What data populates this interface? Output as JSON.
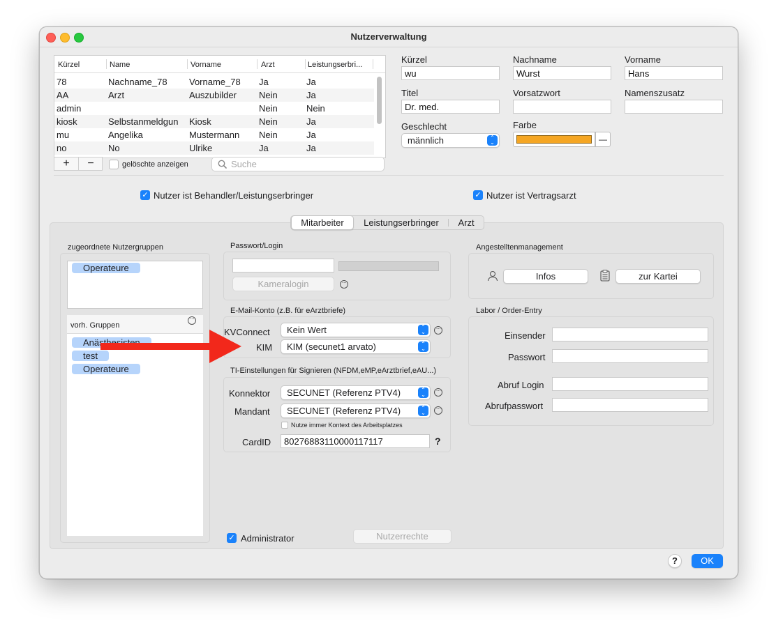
{
  "window": {
    "title": "Nutzerverwaltung"
  },
  "table": {
    "columns": [
      "Kürzel",
      "Name",
      "Vorname",
      "Arzt",
      "Leistungserbri..."
    ],
    "rows": [
      [
        "78",
        "Nachname_78",
        "Vorname_78",
        "Ja",
        "Ja"
      ],
      [
        "AA",
        "Arzt",
        "Auszubilder",
        "Nein",
        "Ja"
      ],
      [
        "admin",
        "",
        "",
        "Nein",
        "Nein"
      ],
      [
        "kiosk",
        "Selbstanmeldgun",
        "Kiosk",
        "Nein",
        "Ja"
      ],
      [
        "mu",
        "Angelika",
        "Mustermann",
        "Nein",
        "Ja"
      ],
      [
        "no",
        "No",
        "Ulrike",
        "Ja",
        "Ja"
      ]
    ],
    "add_label": "+",
    "remove_label": "−",
    "show_deleted_label": "gelöschte anzeigen",
    "search_placeholder": "Suche"
  },
  "person": {
    "kuerzel_label": "Kürzel",
    "kuerzel_value": "wu",
    "nachname_label": "Nachname",
    "nachname_value": "Wurst",
    "vorname_label": "Vorname",
    "vorname_value": "Hans",
    "titel_label": "Titel",
    "titel_value": "Dr. med.",
    "vorsatzwort_label": "Vorsatzwort",
    "vorsatzwort_value": "",
    "namenszusatz_label": "Namenszusatz",
    "namenszusatz_value": "",
    "geschlecht_label": "Geschlecht",
    "geschlecht_value": "männlich",
    "farbe_label": "Farbe",
    "farbe_color": "#f5a623",
    "farbe_button": "—"
  },
  "flags": {
    "behandler_label": "Nutzer ist Behandler/Leistungserbringer",
    "vertragsarzt_label": "Nutzer ist Vertragsarzt"
  },
  "tabs": [
    "Mitarbeiter",
    "Leistungserbringer",
    "Arzt"
  ],
  "groups": {
    "assigned_title": "zugeordnete Nutzergruppen",
    "assigned": [
      "Operateure"
    ],
    "available_title": "vorh. Gruppen",
    "available": [
      "Anästhesisten",
      "test",
      "Operateure"
    ]
  },
  "login": {
    "title": "Passwort/Login",
    "camera_button": "Kameralogin"
  },
  "email": {
    "title": "E-Mail-Konto (z.B. für eArztbriefe)",
    "kvconnect_label": "KVConnect",
    "kvconnect_value": "Kein Wert",
    "kim_label": "KIM",
    "kim_value": "KIM (secunet1 arvato)"
  },
  "ti": {
    "title": "TI-Einstellungen für Signieren (NFDM,eMP,eArztbrief,eAU...)",
    "konnektor_label": "Konnektor",
    "konnektor_value": "SECUNET (Referenz PTV4)",
    "mandant_label": "Mandant",
    "mandant_value": "SECUNET (Referenz PTV4)",
    "context_label": "Nutze immer Kontext des Arbeitsplatzes",
    "cardid_label": "CardID",
    "cardid_value": "80276883110000117117",
    "help": "?"
  },
  "angestellte": {
    "title": "Angestelltenmanagement",
    "infos_button": "Infos",
    "kartei_button": "zur Kartei"
  },
  "labor": {
    "title": "Labor / Order-Entry",
    "einsender_label": "Einsender",
    "passwort_label": "Passwort",
    "abruf_login_label": "Abruf Login",
    "abrufpasswort_label": "Abrufpasswort"
  },
  "footer": {
    "administrator_label": "Administrator",
    "nutzerrechte_button": "Nutzerrechte",
    "help_button": "?",
    "ok_button": "OK"
  },
  "colors": {
    "accent": "#1a82fb",
    "arrow": "#f2281b"
  }
}
